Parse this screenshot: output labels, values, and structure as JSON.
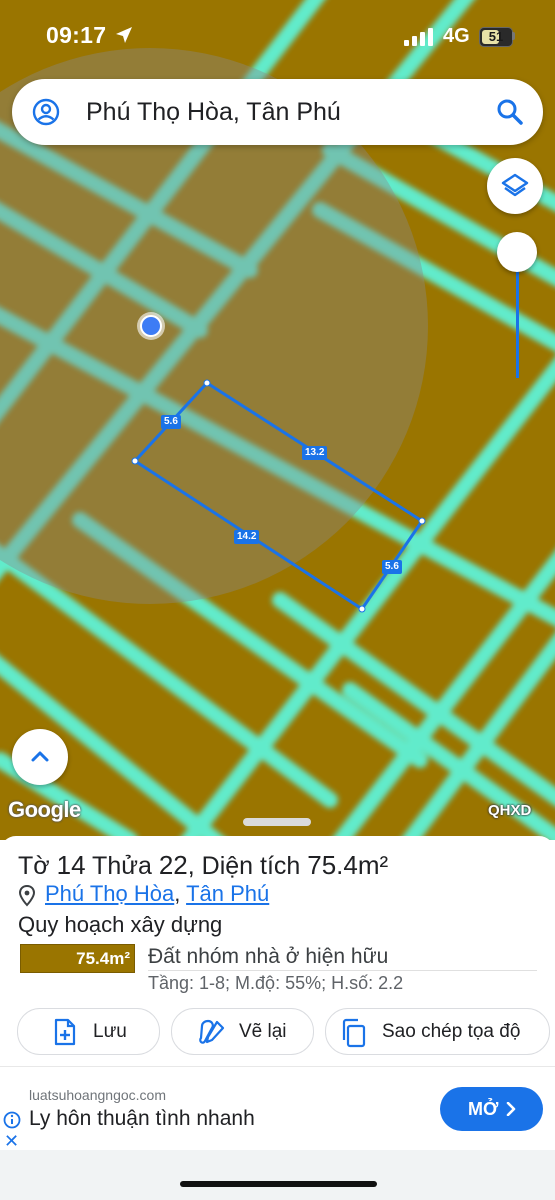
{
  "status_bar": {
    "time": "09:17",
    "network": "4G",
    "battery": "51"
  },
  "search": {
    "query": "Phú Thọ Hòa, Tân Phú"
  },
  "map": {
    "edge_labels": [
      "5.6",
      "13.2",
      "14.2",
      "5.6"
    ],
    "attribution": "Google",
    "layer_tag": "QHXD",
    "colors": {
      "land": "#9a7500",
      "road": "#5ff2d6",
      "parcel_outline": "#1a73e8"
    }
  },
  "parcel": {
    "title_prefix": "Tờ",
    "sheet_no": "14",
    "plot_label": "Thửa",
    "plot_no": "22",
    "area_label": ", Diện tích",
    "area": "75.4m²",
    "ward": "Phú Thọ Hòa",
    "district": "Tân Phú",
    "section_title": "Quy hoạch xây dựng",
    "chip_area": "75.4m²",
    "zone": "Đất nhóm nhà ở hiện hữu",
    "spec": "Tầng: 1-8; M.độ: 55%; H.số: 2.2"
  },
  "actions": {
    "save": "Lưu",
    "redraw": "Vẽ lại",
    "copy_coords": "Sao chép tọa độ"
  },
  "ad": {
    "domain": "luatsuhoangngoc.com",
    "headline": "Ly hôn thuận tình nhanh",
    "cta": "MỞ"
  }
}
